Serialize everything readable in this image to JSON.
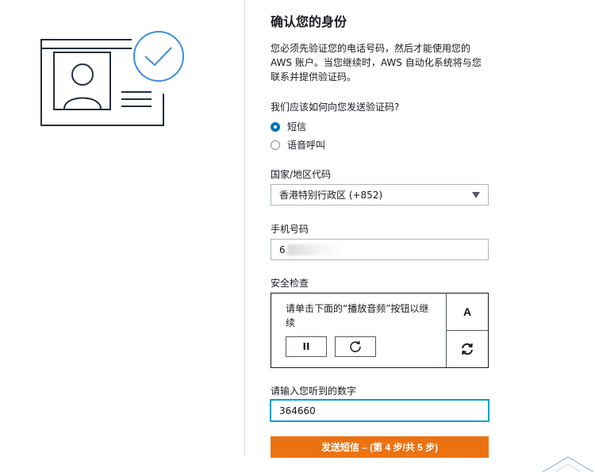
{
  "page": {
    "title": "确认您的身份",
    "description": "您必须先验证您的电话号码，然后才能使用您的 AWS 账户。当您继续时，AWS 自动化系统将与您联系并提供验证码。"
  },
  "method": {
    "question": "我们应该如何向您发送验证码?",
    "options": [
      {
        "label": "短信",
        "selected": true
      },
      {
        "label": "语音呼叫",
        "selected": false
      }
    ]
  },
  "country": {
    "label": "国家/地区代码",
    "value": "香港特别行政区 (+852)"
  },
  "phone": {
    "label": "手机号码",
    "value_visible": "6"
  },
  "security": {
    "label": "安全检查",
    "instruction": "请单击下面的“播放音频”按钮以继续",
    "pause_label": "II",
    "font_toggle_label": "A"
  },
  "code": {
    "label": "请输入您听到的数字",
    "value": "364660"
  },
  "submit": {
    "label": "发送短信 – (第 4 步/共 5 步)"
  },
  "colors": {
    "primary": "#ec7211",
    "link_blue": "#0073bb",
    "focus": "#00a1c9",
    "illustration_blue": "#3e8ddd",
    "text": "#16191f"
  },
  "icons": {
    "illustration": "id-card-verified-illustration",
    "replay": "reload-icon",
    "refresh": "refresh-icon",
    "dropdown": "caret-down-icon"
  }
}
